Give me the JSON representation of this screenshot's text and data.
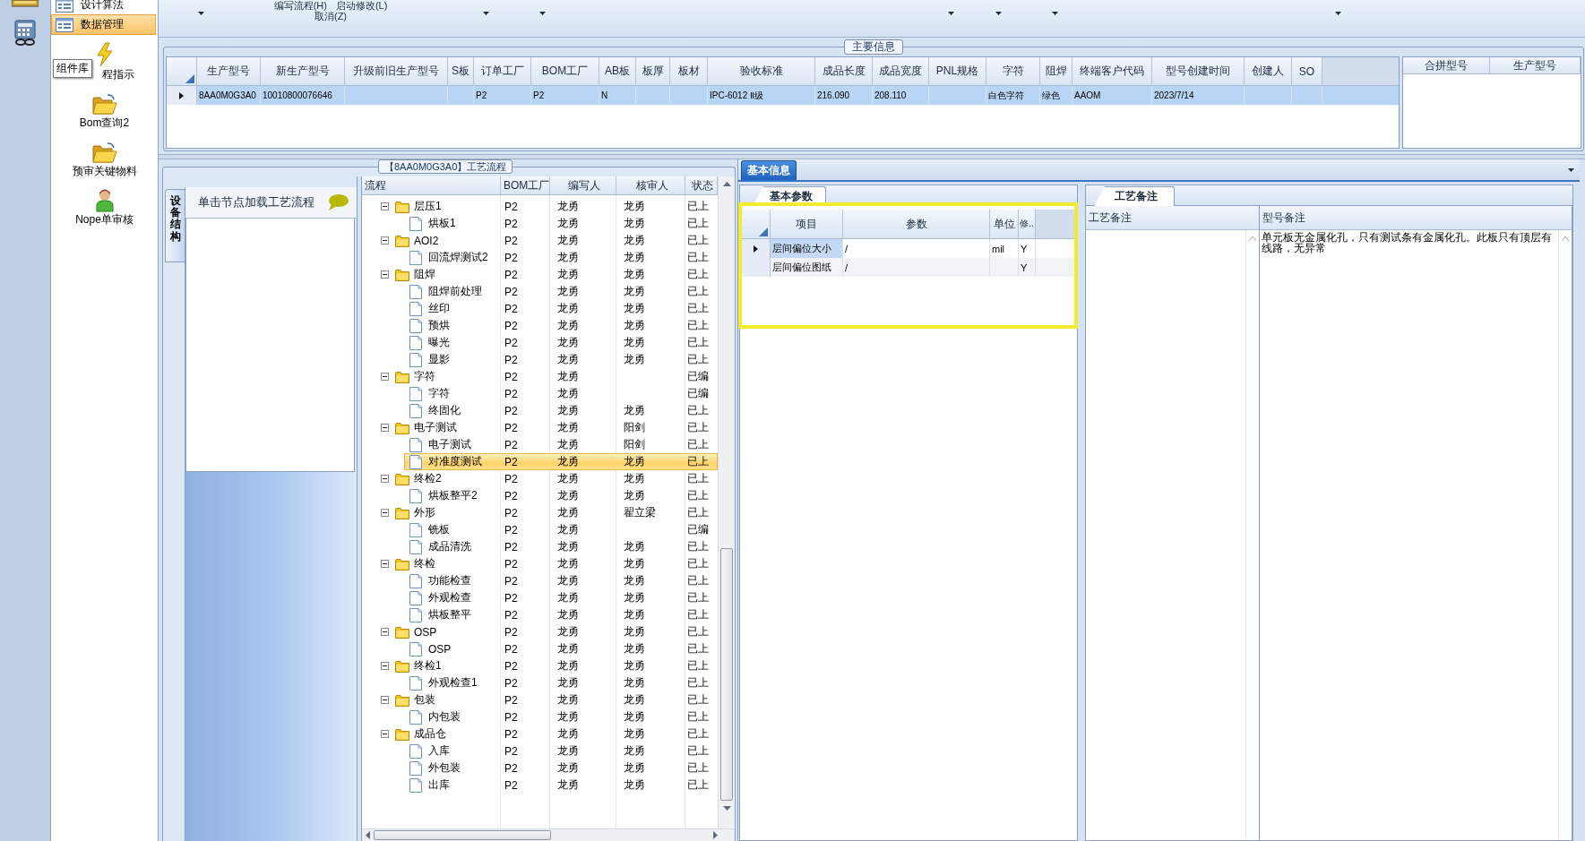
{
  "nav": {
    "items": [
      {
        "label": "设计算法",
        "selected": false
      },
      {
        "label": "数据管理",
        "selected": true
      }
    ],
    "tools": [
      {
        "label": "程指示"
      },
      {
        "label": "Bom查询2"
      },
      {
        "label": "预审关键物料"
      },
      {
        "label": "Nope单审核"
      }
    ],
    "tooltip": "组件库"
  },
  "toolbar": {
    "commands": [
      "编写流程(H)",
      "启动修改(L)",
      "取消(Z)"
    ]
  },
  "main_info": {
    "title": "主要信息",
    "columns": [
      "生产型号",
      "新生产型号",
      "升级前旧生产型号",
      "S板",
      "订单工厂",
      "BOM工厂",
      "AB板",
      "板厚",
      "板材",
      "验收标准",
      "成品长度",
      "成品宽度",
      "PNL规格",
      "字符",
      "阻焊",
      "终端客户代码",
      "型号创建时间",
      "创建人",
      "SO"
    ],
    "rows": [
      {
        "selected": true,
        "cells": [
          "8AA0M0G3A0",
          "10010800076646",
          null,
          null,
          "P2",
          "P2",
          "N",
          null,
          null,
          "IPC-6012 Ⅱ级",
          "216.090",
          "208.110",
          null,
          "白色字符",
          "绿色",
          "AAOM",
          "2023/7/14",
          null,
          null
        ]
      }
    ],
    "side_columns": [
      "合拼型号",
      "生产型号"
    ]
  },
  "flow": {
    "title": "【8AA0M0G3A0】工艺流程",
    "side_tab": "设备结构",
    "hint": "单击节点加载工艺流程",
    "columns": [
      "流程",
      "BOM工厂",
      "编写人",
      "核审人",
      "状态"
    ],
    "nodes": [
      {
        "name": "层压1",
        "bom": "P2",
        "writer": "龙勇",
        "reviewer": "龙勇",
        "status": "已上",
        "selected": false,
        "expanded": true,
        "children": [
          {
            "name": "烘板1",
            "bom": "P2",
            "writer": "龙勇",
            "reviewer": "龙勇",
            "status": "已上",
            "selected": false
          }
        ]
      },
      {
        "name": "AOI2",
        "bom": "P2",
        "writer": "龙勇",
        "reviewer": "龙勇",
        "status": "已上",
        "selected": false,
        "expanded": true,
        "children": [
          {
            "name": "回流焊测试2",
            "bom": "P2",
            "writer": "龙勇",
            "reviewer": "龙勇",
            "status": "已上",
            "selected": false
          }
        ]
      },
      {
        "name": "阻焊",
        "bom": "P2",
        "writer": "龙勇",
        "reviewer": "龙勇",
        "status": "已上",
        "selected": false,
        "expanded": true,
        "children": [
          {
            "name": "阻焊前处理",
            "bom": "P2",
            "writer": "龙勇",
            "reviewer": "龙勇",
            "status": "已上",
            "selected": false
          },
          {
            "name": "丝印",
            "bom": "P2",
            "writer": "龙勇",
            "reviewer": "龙勇",
            "status": "已上",
            "selected": false
          },
          {
            "name": "预烘",
            "bom": "P2",
            "writer": "龙勇",
            "reviewer": "龙勇",
            "status": "已上",
            "selected": false
          },
          {
            "name": "曝光",
            "bom": "P2",
            "writer": "龙勇",
            "reviewer": "龙勇",
            "status": "已上",
            "selected": false
          },
          {
            "name": "显影",
            "bom": "P2",
            "writer": "龙勇",
            "reviewer": "龙勇",
            "status": "已上",
            "selected": false
          }
        ]
      },
      {
        "name": "字符",
        "bom": "P2",
        "writer": "龙勇",
        "status": "已编",
        "selected": false,
        "expanded": true,
        "children": [
          {
            "name": "字符",
            "bom": "P2",
            "writer": "龙勇",
            "status": "已编",
            "selected": false
          },
          {
            "name": "终固化",
            "bom": "P2",
            "writer": "龙勇",
            "reviewer": "龙勇",
            "status": "已上",
            "selected": false
          }
        ]
      },
      {
        "name": "电子测试",
        "bom": "P2",
        "writer": "龙勇",
        "reviewer": "阳剑",
        "status": "已上",
        "selected": false,
        "expanded": true,
        "children": [
          {
            "name": "电子测试",
            "bom": "P2",
            "writer": "龙勇",
            "reviewer": "阳剑",
            "status": "已上",
            "selected": false
          },
          {
            "name": "对准度测试",
            "bom": "P2",
            "writer": "龙勇",
            "reviewer": "龙勇",
            "status": "已上",
            "selected": true
          }
        ]
      },
      {
        "name": "终检2",
        "bom": "P2",
        "writer": "龙勇",
        "reviewer": "龙勇",
        "status": "已上",
        "selected": false,
        "expanded": true,
        "children": [
          {
            "name": "烘板整平2",
            "bom": "P2",
            "writer": "龙勇",
            "reviewer": "龙勇",
            "status": "已上",
            "selected": false
          }
        ]
      },
      {
        "name": "外形",
        "bom": "P2",
        "writer": "龙勇",
        "reviewer": "翟立梁",
        "status": "已上",
        "selected": false,
        "expanded": true,
        "children": [
          {
            "name": "铣板",
            "bom": "P2",
            "writer": "龙勇",
            "status": "已编",
            "selected": false
          },
          {
            "name": "成品清洗",
            "bom": "P2",
            "writer": "龙勇",
            "reviewer": "龙勇",
            "status": "已上",
            "selected": false
          }
        ]
      },
      {
        "name": "终检",
        "bom": "P2",
        "writer": "龙勇",
        "reviewer": "龙勇",
        "status": "已上",
        "selected": false,
        "expanded": true,
        "children": [
          {
            "name": "功能检查",
            "bom": "P2",
            "writer": "龙勇",
            "reviewer": "龙勇",
            "status": "已上",
            "selected": false
          },
          {
            "name": "外观检查",
            "bom": "P2",
            "writer": "龙勇",
            "reviewer": "龙勇",
            "status": "已上",
            "selected": false
          },
          {
            "name": "烘板整平",
            "bom": "P2",
            "writer": "龙勇",
            "reviewer": "龙勇",
            "status": "已上",
            "selected": false
          }
        ]
      },
      {
        "name": "OSP",
        "bom": "P2",
        "writer": "龙勇",
        "reviewer": "龙勇",
        "status": "已上",
        "selected": false,
        "expanded": true,
        "children": [
          {
            "name": "OSP",
            "bom": "P2",
            "writer": "龙勇",
            "reviewer": "龙勇",
            "status": "已上",
            "selected": false
          }
        ]
      },
      {
        "name": "终检1",
        "bom": "P2",
        "writer": "龙勇",
        "reviewer": "龙勇",
        "status": "已上",
        "selected": false,
        "expanded": true,
        "children": [
          {
            "name": "外观检查1",
            "bom": "P2",
            "writer": "龙勇",
            "reviewer": "龙勇",
            "status": "已上",
            "selected": false
          }
        ]
      },
      {
        "name": "包装",
        "bom": "P2",
        "writer": "龙勇",
        "reviewer": "龙勇",
        "status": "已上",
        "selected": false,
        "expanded": true,
        "children": [
          {
            "name": "内包装",
            "bom": "P2",
            "writer": "龙勇",
            "reviewer": "龙勇",
            "status": "已上",
            "selected": false
          }
        ]
      },
      {
        "name": "成品仓",
        "bom": "P2",
        "writer": "龙勇",
        "reviewer": "龙勇",
        "status": "已上",
        "selected": false,
        "expanded": true,
        "children": [
          {
            "name": "入库",
            "bom": "P2",
            "writer": "龙勇",
            "reviewer": "龙勇",
            "status": "已上",
            "selected": false
          },
          {
            "name": "外包装",
            "bom": "P2",
            "writer": "龙勇",
            "reviewer": "龙勇",
            "status": "已上",
            "selected": false
          },
          {
            "name": "出库",
            "bom": "P2",
            "writer": "龙勇",
            "reviewer": "龙勇",
            "status": "已上",
            "selected": false
          }
        ]
      }
    ]
  },
  "detail": {
    "tabs": [
      {
        "label": "基本信息",
        "selected": true
      }
    ],
    "params_tabs": [
      {
        "label": "基本参数",
        "selected": true
      }
    ],
    "params": {
      "columns": [
        "项目",
        "参数",
        "单位",
        "修.."
      ],
      "rows": [
        {
          "selected": true,
          "cells": [
            "层间偏位大小",
            "/",
            "mil",
            "Y"
          ]
        },
        {
          "selected": false,
          "cells": [
            "层间偏位图纸",
            "/",
            null,
            "Y"
          ]
        }
      ]
    },
    "notes_tabs": [
      {
        "label": "工艺备注",
        "selected": true
      }
    ],
    "notes": {
      "columns": [
        "工艺备注",
        "型号备注"
      ],
      "cells": [
        null,
        "单元板无金属化孔，只有测试条有金属化孔。此板只有顶层有线路，无异常"
      ]
    }
  }
}
